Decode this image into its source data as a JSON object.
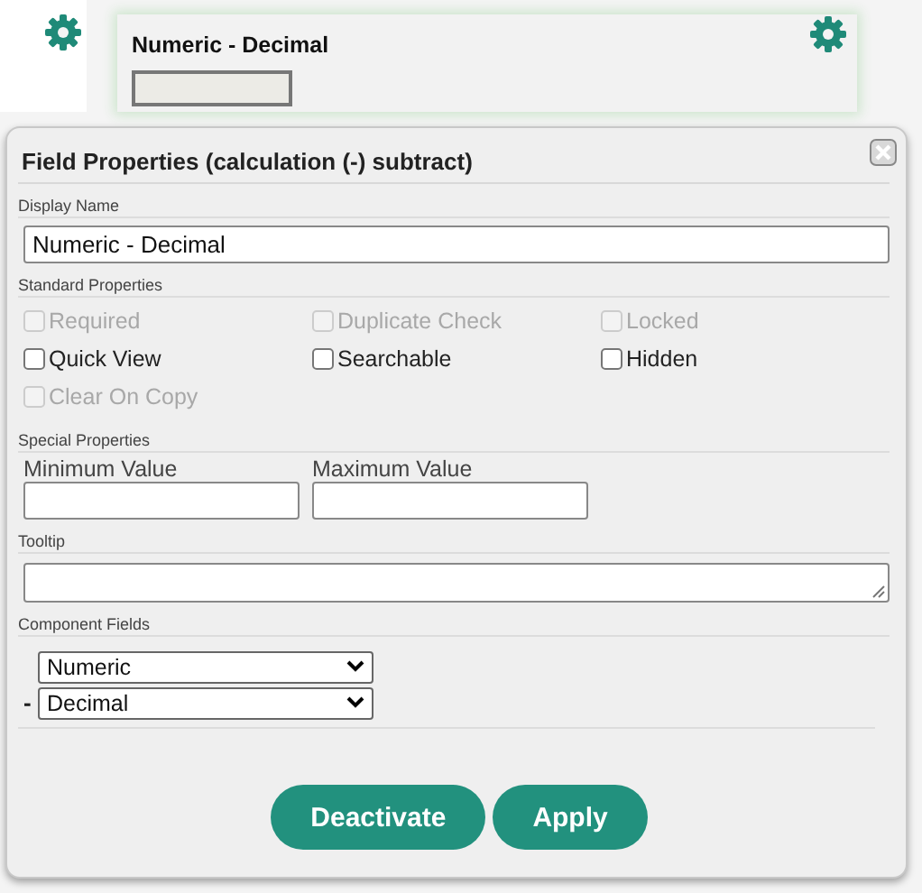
{
  "card": {
    "title": "Numeric - Decimal"
  },
  "dialog": {
    "title": "Field Properties (calculation (-) subtract)",
    "display_name": {
      "label": "Display Name",
      "value": "Numeric - Decimal"
    },
    "standard_properties": {
      "label": "Standard Properties",
      "options": [
        {
          "label": "Required",
          "checked": false,
          "disabled": true
        },
        {
          "label": "Duplicate Check",
          "checked": false,
          "disabled": true
        },
        {
          "label": "Locked",
          "checked": false,
          "disabled": true
        },
        {
          "label": "Quick View",
          "checked": false,
          "disabled": false
        },
        {
          "label": "Searchable",
          "checked": false,
          "disabled": false
        },
        {
          "label": "Hidden",
          "checked": false,
          "disabled": false
        },
        {
          "label": "Clear On Copy",
          "checked": false,
          "disabled": true
        }
      ]
    },
    "special_properties": {
      "label": "Special Properties",
      "fields": [
        {
          "label": "Minimum Value"
        },
        {
          "label": "Maximum Value"
        }
      ]
    },
    "tooltip": {
      "label": "Tooltip"
    },
    "component_fields": {
      "label": "Component Fields",
      "rows": [
        {
          "value": "Numeric"
        },
        {
          "operator": "-",
          "value": "Decimal"
        }
      ]
    },
    "buttons": [
      "Deactivate",
      "Apply"
    ]
  }
}
